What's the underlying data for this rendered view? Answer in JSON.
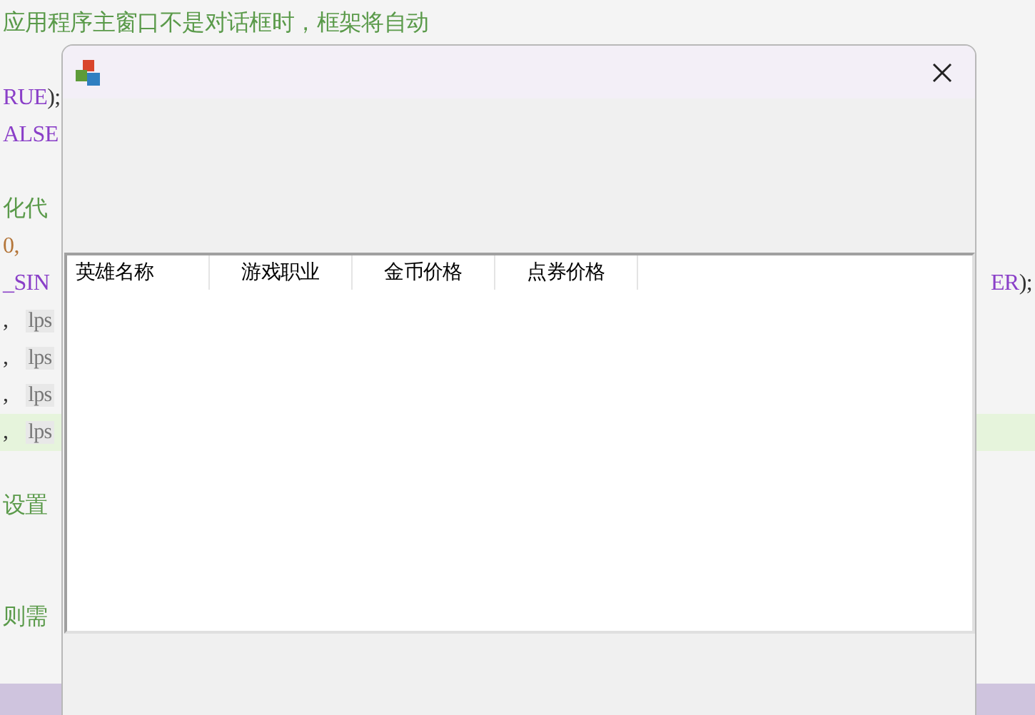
{
  "editor": {
    "lines": [
      {
        "kind": "text",
        "highlighted": false,
        "parts": [
          {
            "text": "应用程序主窗口不是对话框时，框架将自动",
            "kind": "comment"
          }
        ]
      },
      {
        "kind": "blank"
      },
      {
        "kind": "text",
        "highlighted": false,
        "parts": [
          {
            "text": "RUE",
            "kind": "keyword"
          },
          {
            "text": ");",
            "kind": "plain"
          }
        ]
      },
      {
        "kind": "text",
        "highlighted": false,
        "parts": [
          {
            "text": "ALSE",
            "kind": "keyword"
          }
        ]
      },
      {
        "kind": "blank"
      },
      {
        "kind": "text",
        "highlighted": false,
        "parts": [
          {
            "text": "化代",
            "kind": "comment"
          }
        ]
      },
      {
        "kind": "text",
        "highlighted": false,
        "parts": [
          {
            "text": "0,",
            "kind": "number"
          }
        ]
      },
      {
        "kind": "text",
        "highlighted": false,
        "parts": [
          {
            "text": "_SIN",
            "kind": "keyword"
          }
        ],
        "right": [
          {
            "text": "ER",
            "kind": "keyword"
          },
          {
            "text": ");",
            "kind": "plain"
          }
        ]
      },
      {
        "kind": "text",
        "highlighted": false,
        "parts": [
          {
            "text": ",",
            "kind": "plain"
          },
          {
            "text": "lps",
            "kind": "param"
          }
        ]
      },
      {
        "kind": "text",
        "highlighted": false,
        "parts": [
          {
            "text": ",",
            "kind": "plain"
          },
          {
            "text": "lps",
            "kind": "param"
          }
        ]
      },
      {
        "kind": "text",
        "highlighted": false,
        "parts": [
          {
            "text": ",",
            "kind": "plain"
          },
          {
            "text": "lps",
            "kind": "param"
          }
        ]
      },
      {
        "kind": "text",
        "highlighted": true,
        "parts": [
          {
            "text": ",",
            "kind": "plain"
          },
          {
            "text": "lps",
            "kind": "param"
          }
        ]
      },
      {
        "kind": "blank"
      },
      {
        "kind": "text",
        "highlighted": false,
        "parts": [
          {
            "text": "设置",
            "kind": "comment"
          }
        ]
      },
      {
        "kind": "blank"
      },
      {
        "kind": "blank"
      },
      {
        "kind": "text",
        "highlighted": false,
        "parts": [
          {
            "text": "则需",
            "kind": "comment"
          }
        ]
      }
    ]
  },
  "dialog": {
    "list": {
      "columns": [
        "英雄名称",
        "游戏职业",
        "金币价格",
        "点券价格"
      ]
    }
  }
}
